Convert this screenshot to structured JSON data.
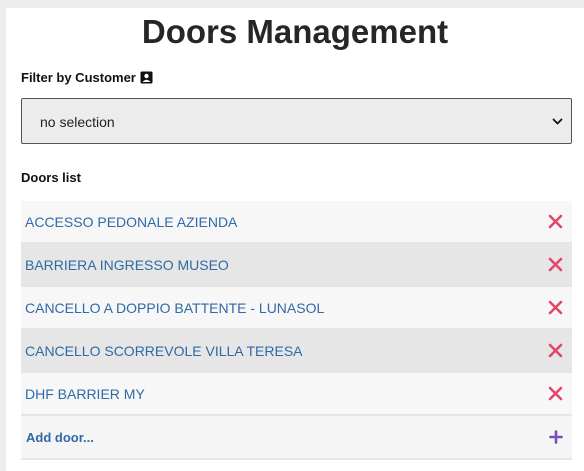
{
  "page": {
    "title": "Doors Management"
  },
  "filter": {
    "label": "Filter by Customer",
    "icon": "person-card-icon",
    "selected": "no selection"
  },
  "doors": {
    "label": "Doors list",
    "items": [
      {
        "name": "ACCESSO PEDONALE AZIENDA"
      },
      {
        "name": "BARRIERA INGRESSO MUSEO"
      },
      {
        "name": "CANCELLO A DOPPIO BATTENTE - LUNASOL"
      },
      {
        "name": "CANCELLO SCORREVOLE VILLA TERESA"
      },
      {
        "name": "DHF BARRIER MY"
      }
    ],
    "add_label": "Add door..."
  },
  "colors": {
    "link": "#2f6aa7",
    "delete": "#e0476a",
    "add": "#7b4fb5"
  }
}
